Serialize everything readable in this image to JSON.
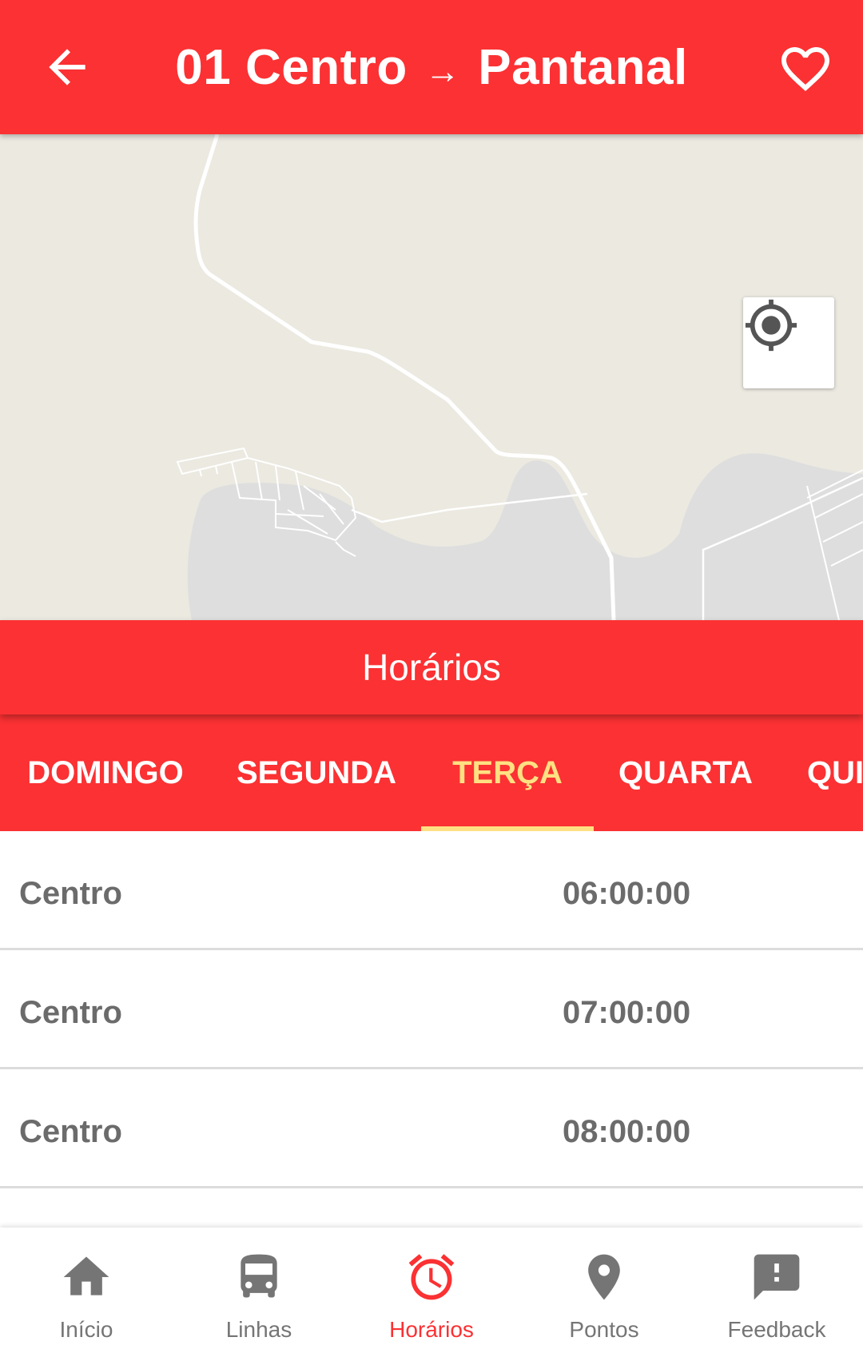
{
  "colors": {
    "primary": "#fb3133",
    "accent": "#ffe082",
    "text_grey": "#6b6b6b",
    "nav_inactive": "#757575"
  },
  "header": {
    "back_icon": "arrow-left-icon",
    "title_from": "01 Centro",
    "title_arrow": "→",
    "title_to": "Pantanal",
    "favorite_icon": "heart-outline-icon"
  },
  "map": {
    "locate_icon": "my-location-icon"
  },
  "section": {
    "title": "Horários"
  },
  "tabs": [
    {
      "label": "DOMINGO",
      "active": false
    },
    {
      "label": "SEGUNDA",
      "active": false
    },
    {
      "label": "TERÇA",
      "active": true
    },
    {
      "label": "QUARTA",
      "active": false
    },
    {
      "label": "QUI",
      "active": false
    }
  ],
  "schedule": [
    {
      "stop": "Centro",
      "time": "06:00:00"
    },
    {
      "stop": "Centro",
      "time": "07:00:00"
    },
    {
      "stop": "Centro",
      "time": "08:00:00"
    }
  ],
  "bottom_nav": [
    {
      "label": "Início",
      "icon": "home-icon",
      "active": false
    },
    {
      "label": "Linhas",
      "icon": "bus-icon",
      "active": false
    },
    {
      "label": "Horários",
      "icon": "alarm-icon",
      "active": true
    },
    {
      "label": "Pontos",
      "icon": "place-icon",
      "active": false
    },
    {
      "label": "Feedback",
      "icon": "feedback-icon",
      "active": false
    }
  ]
}
